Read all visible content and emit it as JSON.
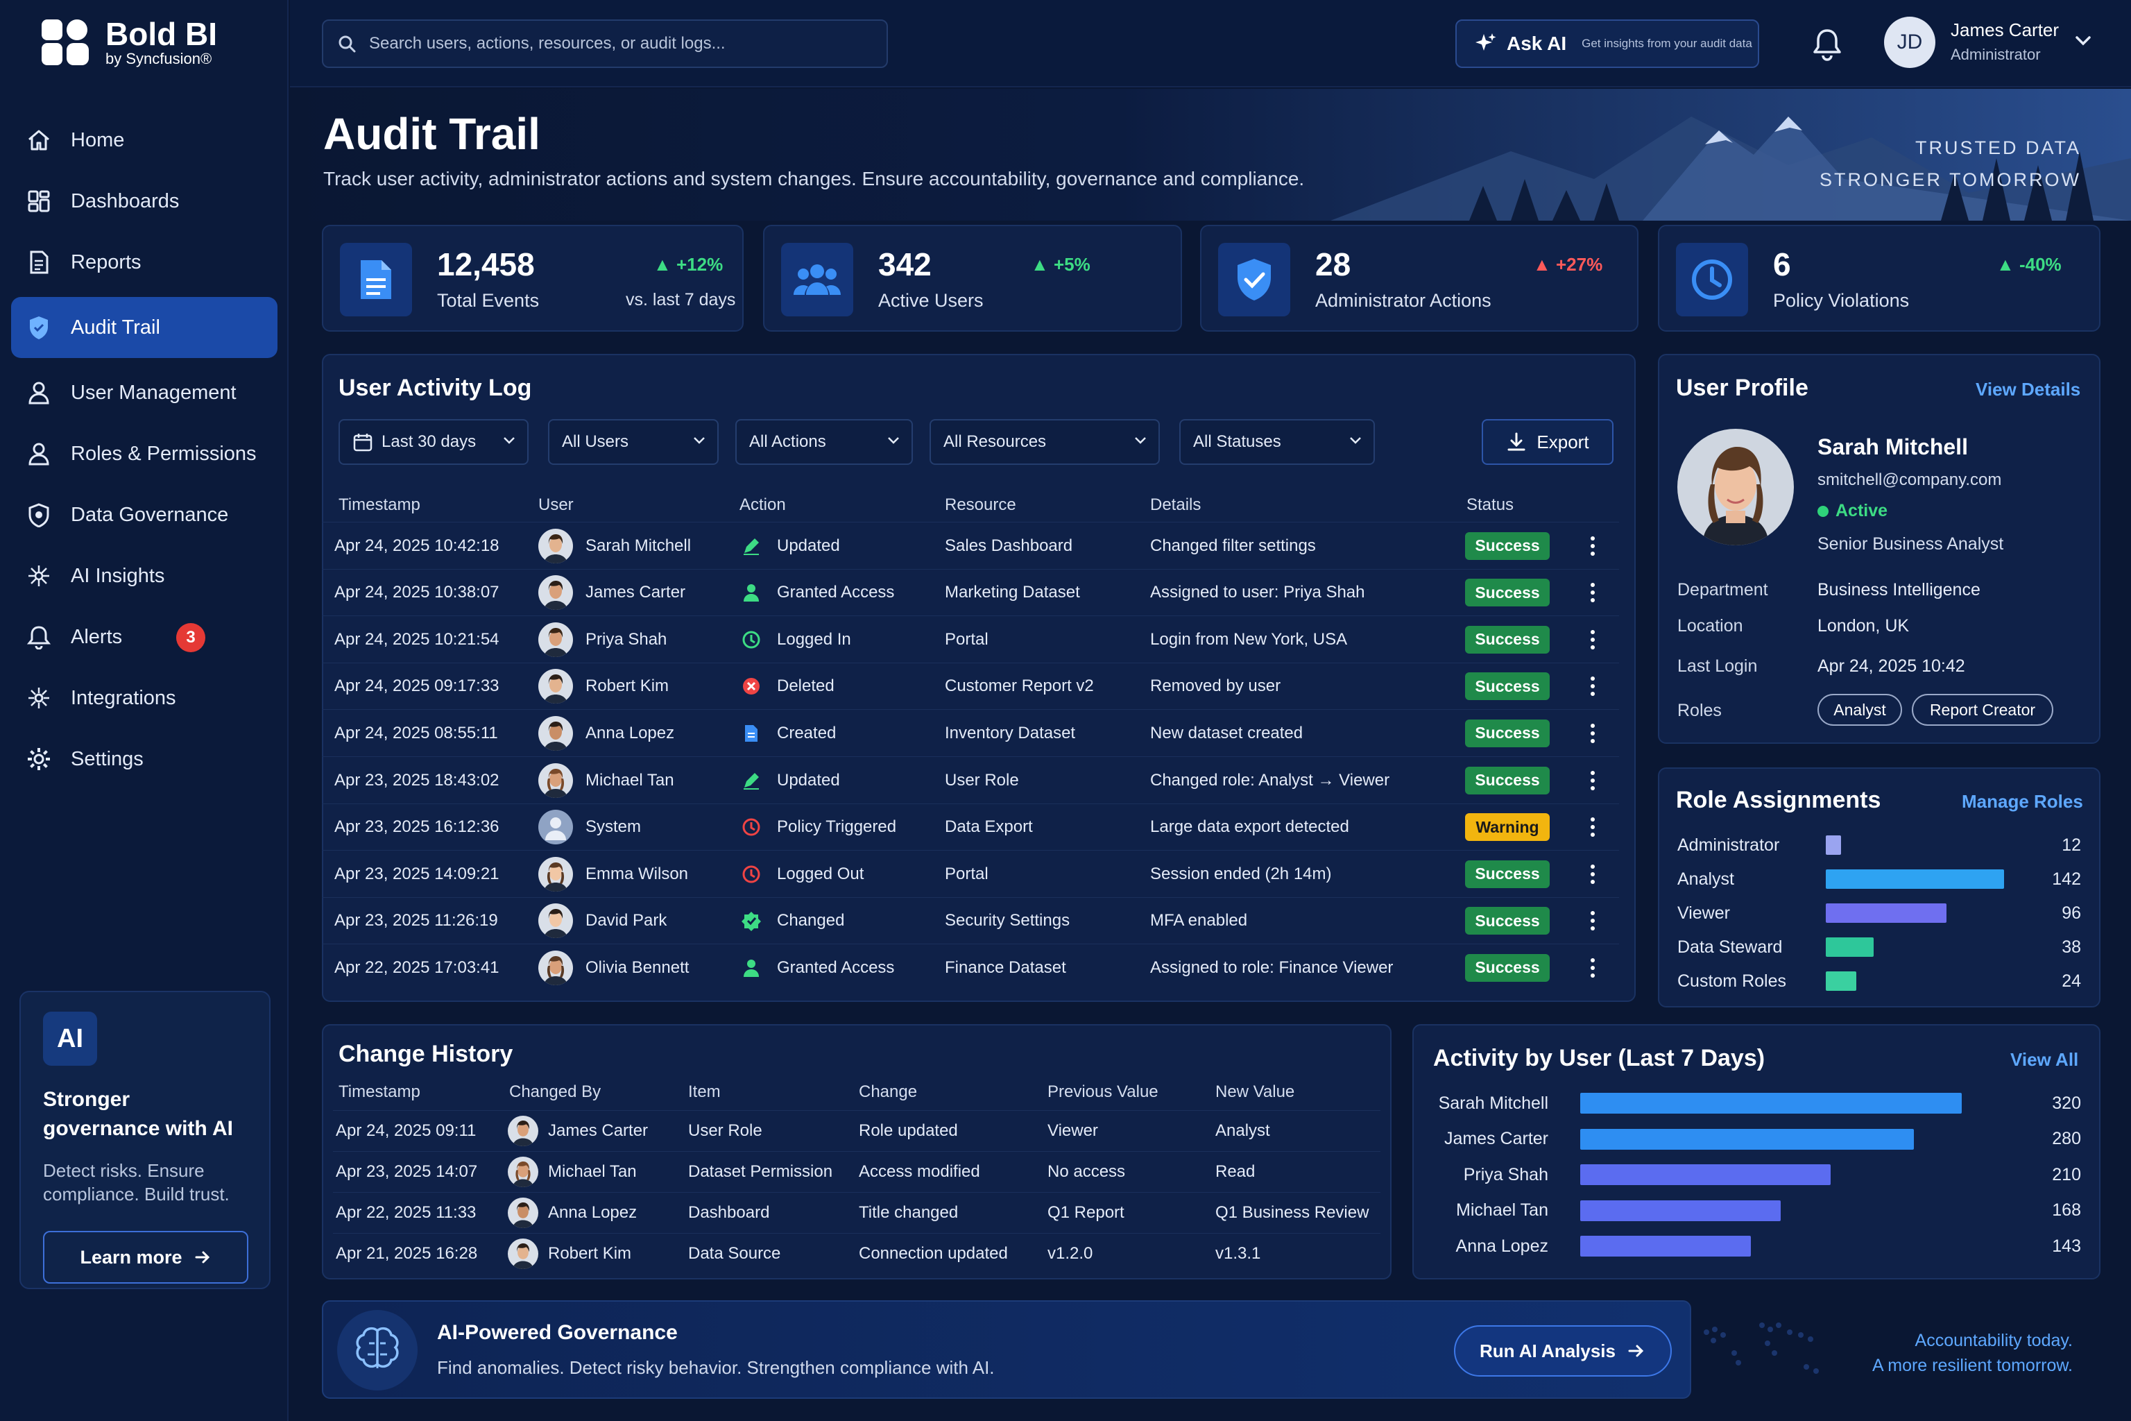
{
  "brand": {
    "name": "Bold BI",
    "sub": "by Syncfusion®"
  },
  "search": {
    "placeholder": "Search users, actions, resources, or audit logs..."
  },
  "ask_ai": {
    "label": "Ask AI",
    "sub": "Get insights from your audit data"
  },
  "user": {
    "initials": "JD",
    "name": "James Carter",
    "role": "Administrator"
  },
  "nav": [
    {
      "label": "Home",
      "icon": "home-icon"
    },
    {
      "label": "Dashboards",
      "icon": "dashboards-icon"
    },
    {
      "label": "Reports",
      "icon": "reports-icon"
    },
    {
      "label": "Audit Trail",
      "icon": "shield-icon",
      "active": true
    },
    {
      "label": "User Management",
      "icon": "user-icon"
    },
    {
      "label": "Roles & Permissions",
      "icon": "user-icon"
    },
    {
      "label": "Data Governance",
      "icon": "governance-icon"
    },
    {
      "label": "AI Insights",
      "icon": "sparkle-icon"
    },
    {
      "label": "Alerts",
      "icon": "bell-icon",
      "badge": "3"
    },
    {
      "label": "Integrations",
      "icon": "integrations-icon"
    },
    {
      "label": "Settings",
      "icon": "gear-icon"
    }
  ],
  "promo": {
    "badge": "AI",
    "title": "Stronger governance with AI",
    "text": "Detect risks. Ensure compliance. Build trust.",
    "button": "Learn more"
  },
  "page": {
    "title": "Audit Trail",
    "subtitle": "Track user activity, administrator actions and system changes. Ensure accountability, governance and compliance.",
    "tagline1": "TRUSTED DATA",
    "tagline2": "STRONGER TOMORROW"
  },
  "stats": [
    {
      "value": "12,458",
      "label": "Total Events",
      "change": "+12%",
      "sub": "vs. last 7 days",
      "change_color": "#3ddc84"
    },
    {
      "value": "342",
      "label": "Active Users",
      "change": "+5%",
      "change_color": "#3ddc84"
    },
    {
      "value": "28",
      "label": "Administrator Actions",
      "change": "+27%",
      "change_color": "#ff5a5a"
    },
    {
      "value": "6",
      "label": "Policy Violations",
      "change": "-40%",
      "change_color": "#3ddc84"
    }
  ],
  "activity_log": {
    "title": "User Activity Log",
    "filters": [
      "Last 30 days",
      "All Users",
      "All Actions",
      "All Resources",
      "All Statuses"
    ],
    "export": "Export",
    "columns": [
      "Timestamp",
      "User",
      "Action",
      "Resource",
      "Details",
      "Status"
    ],
    "rows": [
      {
        "ts": "Apr 24, 2025 10:42:18",
        "user": "Sarah Mitchell",
        "action": "Updated",
        "action_icon": "pencil-icon",
        "resource": "Sales Dashboard",
        "details": "Changed filter settings",
        "status": "Success"
      },
      {
        "ts": "Apr 24, 2025 10:38:07",
        "user": "James Carter",
        "action": "Granted Access",
        "action_icon": "user-add-icon",
        "resource": "Marketing Dataset",
        "details": "Assigned to user: Priya Shah",
        "status": "Success"
      },
      {
        "ts": "Apr 24, 2025 10:21:54",
        "user": "Priya Shah",
        "action": "Logged In",
        "action_icon": "clock-icon",
        "resource": "Portal",
        "details": "Login from New York, USA",
        "status": "Success"
      },
      {
        "ts": "Apr 24, 2025 09:17:33",
        "user": "Robert Kim",
        "action": "Deleted",
        "action_icon": "delete-icon",
        "resource": "Customer Report v2",
        "details": "Removed by user",
        "status": "Success"
      },
      {
        "ts": "Apr 24, 2025 08:55:11",
        "user": "Anna Lopez",
        "action": "Created",
        "action_icon": "document-icon",
        "resource": "Inventory Dataset",
        "details": "New dataset created",
        "status": "Success"
      },
      {
        "ts": "Apr 23, 2025 18:43:02",
        "user": "Michael Tan",
        "action": "Updated",
        "action_icon": "pencil-icon",
        "resource": "User Role",
        "details": "Changed role: Analyst → Viewer",
        "status": "Success"
      },
      {
        "ts": "Apr 23, 2025 16:12:36",
        "user": "System",
        "action": "Policy Triggered",
        "action_icon": "alert-clock-icon",
        "resource": "Data Export",
        "details": "Large data export detected",
        "status": "Warning"
      },
      {
        "ts": "Apr 23, 2025 14:09:21",
        "user": "Emma Wilson",
        "action": "Logged Out",
        "action_icon": "logout-icon",
        "resource": "Portal",
        "details": "Session ended (2h 14m)",
        "status": "Success"
      },
      {
        "ts": "Apr 23, 2025 11:26:19",
        "user": "David Park",
        "action": "Changed",
        "action_icon": "settings-change-icon",
        "resource": "Security Settings",
        "details": "MFA enabled",
        "status": "Success"
      },
      {
        "ts": "Apr 22, 2025 17:03:41",
        "user": "Olivia Bennett",
        "action": "Granted Access",
        "action_icon": "user-add-icon",
        "resource": "Finance Dataset",
        "details": "Assigned to role: Finance Viewer",
        "status": "Success"
      }
    ]
  },
  "profile": {
    "title": "User Profile",
    "link": "View Details",
    "name": "Sarah Mitchell",
    "email": "smitchell@company.com",
    "status": "Active",
    "job": "Senior Business Analyst",
    "fields": [
      {
        "label": "Department",
        "value": "Business Intelligence"
      },
      {
        "label": "Location",
        "value": "London, UK"
      },
      {
        "label": "Last Login",
        "value": "Apr 24, 2025 10:42"
      },
      {
        "label": "Roles",
        "value": ""
      }
    ],
    "roles": [
      "Analyst",
      "Report Creator"
    ]
  },
  "role_assignments": {
    "title": "Role Assignments",
    "link": "Manage Roles",
    "items": [
      {
        "label": "Administrator",
        "value": 12,
        "color": "#9aa4f0"
      },
      {
        "label": "Analyst",
        "value": 142,
        "color": "#2ea3f2"
      },
      {
        "label": "Viewer",
        "value": 96,
        "color": "#6f6ff0"
      },
      {
        "label": "Data Steward",
        "value": 38,
        "color": "#2ec79a"
      },
      {
        "label": "Custom Roles",
        "value": 24,
        "color": "#3ad0a0"
      }
    ],
    "max": 160
  },
  "change_history": {
    "title": "Change History",
    "columns": [
      "Timestamp",
      "Changed By",
      "Item",
      "Change",
      "Previous Value",
      "New Value"
    ],
    "rows": [
      {
        "ts": "Apr 24, 2025 09:11",
        "by": "James Carter",
        "item": "User Role",
        "change": "Role updated",
        "prev": "Viewer",
        "new": "Analyst"
      },
      {
        "ts": "Apr 23, 2025 14:07",
        "by": "Michael Tan",
        "item": "Dataset Permission",
        "change": "Access modified",
        "prev": "No access",
        "new": "Read"
      },
      {
        "ts": "Apr 22, 2025 11:33",
        "by": "Anna Lopez",
        "item": "Dashboard",
        "change": "Title changed",
        "prev": "Q1 Report",
        "new": "Q1 Business Review"
      },
      {
        "ts": "Apr 21, 2025 16:28",
        "by": "Robert Kim",
        "item": "Data Source",
        "change": "Connection updated",
        "prev": "v1.2.0",
        "new": "v1.3.1"
      }
    ]
  },
  "activity_by_user": {
    "title": "Activity by User (Last 7 Days)",
    "link": "View All",
    "items": [
      {
        "label": "Sarah Mitchell",
        "value": 320,
        "color": "#2e8ef2"
      },
      {
        "label": "James Carter",
        "value": 280,
        "color": "#2e8ef2"
      },
      {
        "label": "Priya Shah",
        "value": 210,
        "color": "#5b6cf0"
      },
      {
        "label": "Michael Tan",
        "value": 168,
        "color": "#5b6cf0"
      },
      {
        "label": "Anna Lopez",
        "value": 143,
        "color": "#5b6cf0"
      }
    ],
    "max": 320
  },
  "banner": {
    "title": "AI-Powered Governance",
    "text": "Find anomalies. Detect risky behavior. Strengthen compliance with AI.",
    "button": "Run AI Analysis"
  },
  "footer_tagline": {
    "line1": "Accountability today.",
    "line2": "A more resilient tomorrow."
  }
}
